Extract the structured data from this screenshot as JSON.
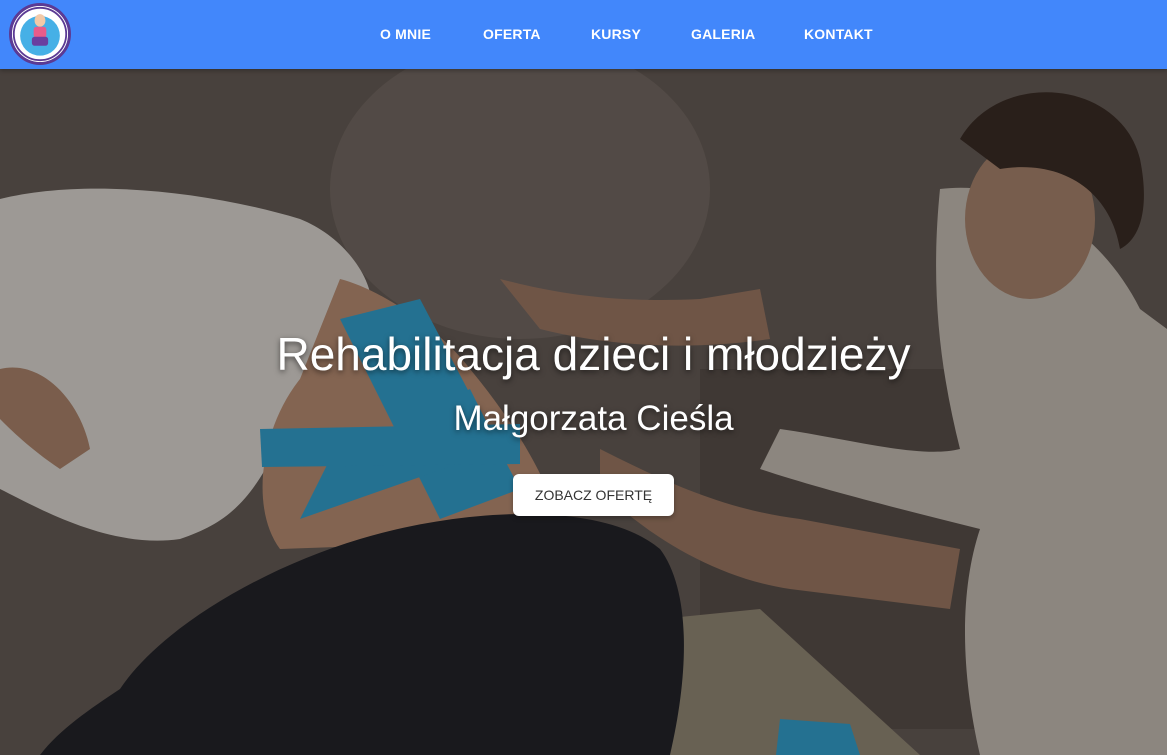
{
  "nav": {
    "logo_alt": "logo",
    "items": [
      {
        "label": "O MNIE"
      },
      {
        "label": "OFERTA"
      },
      {
        "label": "KURSY"
      },
      {
        "label": "GALERIA"
      },
      {
        "label": "KONTAKT"
      }
    ]
  },
  "hero": {
    "title": "Rehabilitacja dzieci i młodzieży",
    "subtitle": "Małgorzata Cieśla",
    "cta_label": "ZOBACZ OFERTĘ"
  },
  "colors": {
    "navbar": "#4287fb",
    "tape": "#35a7d6"
  }
}
